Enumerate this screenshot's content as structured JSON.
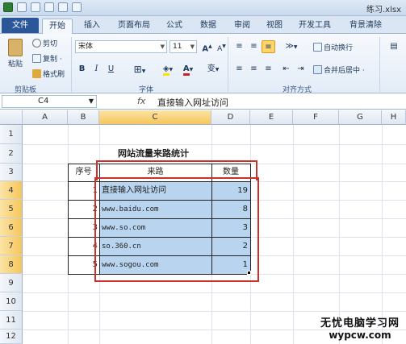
{
  "window": {
    "doc_title": "练习.xlsx"
  },
  "tabs": [
    "文件",
    "开始",
    "插入",
    "页面布局",
    "公式",
    "数据",
    "审阅",
    "视图",
    "开发工具",
    "背景清除"
  ],
  "ribbon": {
    "cut": "剪切",
    "copy": "复制 ·",
    "format_painter": "格式刷",
    "paste": "粘贴",
    "clipboard_group": "剪贴板",
    "font_name": "宋体",
    "font_size": "11",
    "grow_font": "A",
    "shrink_font": "A",
    "bold": "B",
    "italic": "I",
    "underline": "U",
    "font_color": "A",
    "wen": "变",
    "font_group": "字体",
    "wrap_text": "自动换行",
    "merge_center": "合并后居中 ·",
    "align_group": "对齐方式",
    "font_color_hex": "#d01f1f",
    "fill_color_hex": "#ffe100"
  },
  "formula_bar": {
    "name_box": "C4",
    "fx": "fx",
    "content": "直接输入网址访问"
  },
  "columns": [
    "A",
    "B",
    "C",
    "D",
    "E",
    "F",
    "G",
    "H"
  ],
  "rows": [
    "1",
    "2",
    "3",
    "4",
    "5",
    "6",
    "7",
    "8",
    "9",
    "10",
    "11",
    "12"
  ],
  "table": {
    "title": "网站流量来路统计",
    "headers": {
      "no": "序号",
      "source": "来路",
      "count": "数量"
    },
    "rows": [
      {
        "no": "1",
        "source": "直接输入网址访问",
        "count": "19"
      },
      {
        "no": "2",
        "source": "www.baidu.com",
        "count": "8"
      },
      {
        "no": "3",
        "source": "www.so.com",
        "count": "3"
      },
      {
        "no": "4",
        "source": "so.360.cn",
        "count": "2"
      },
      {
        "no": "5",
        "source": "www.sogou.com",
        "count": "1"
      }
    ]
  },
  "watermark": {
    "line1": "无忧电脑学习网",
    "line2": "wypcw.com"
  }
}
